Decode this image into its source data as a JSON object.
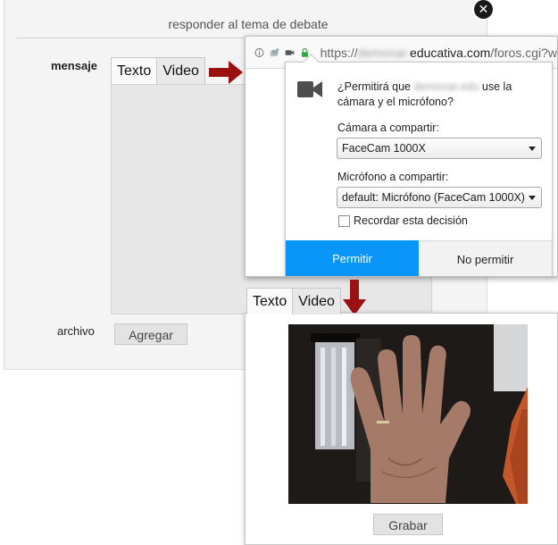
{
  "form": {
    "header": "responder al tema de debate",
    "mensaje_label": "mensaje",
    "archivo_label": "archivo",
    "agregar_button": "Agregar",
    "tabs": [
      {
        "label": "Texto",
        "active": false
      },
      {
        "label": "Video",
        "active": true
      }
    ]
  },
  "browser": {
    "url_prefix": "https://",
    "url_domain": "educativa.com",
    "url_path": "/foros.cgi?w",
    "permission": {
      "question_start": "¿Permitirá que ",
      "question_end": " use la cámara y el micrófono?",
      "camera_label": "Cámara a compartir:",
      "camera_value": "FaceCam 1000X",
      "mic_label": "Micrófono a compartir:",
      "mic_value": "default: Micrófono (FaceCam 1000X)",
      "remember_label": "Recordar esta decisión",
      "allow_button": "Permitir",
      "deny_button": "No permitir"
    }
  },
  "video": {
    "tabs": [
      {
        "label": "Texto",
        "active": false
      },
      {
        "label": "Video",
        "active": true
      }
    ],
    "record_button": "Grabar"
  },
  "colors": {
    "allow_blue": "#0996f8",
    "arrow_red": "#9b1010",
    "lock_green": "#2fa43f"
  }
}
